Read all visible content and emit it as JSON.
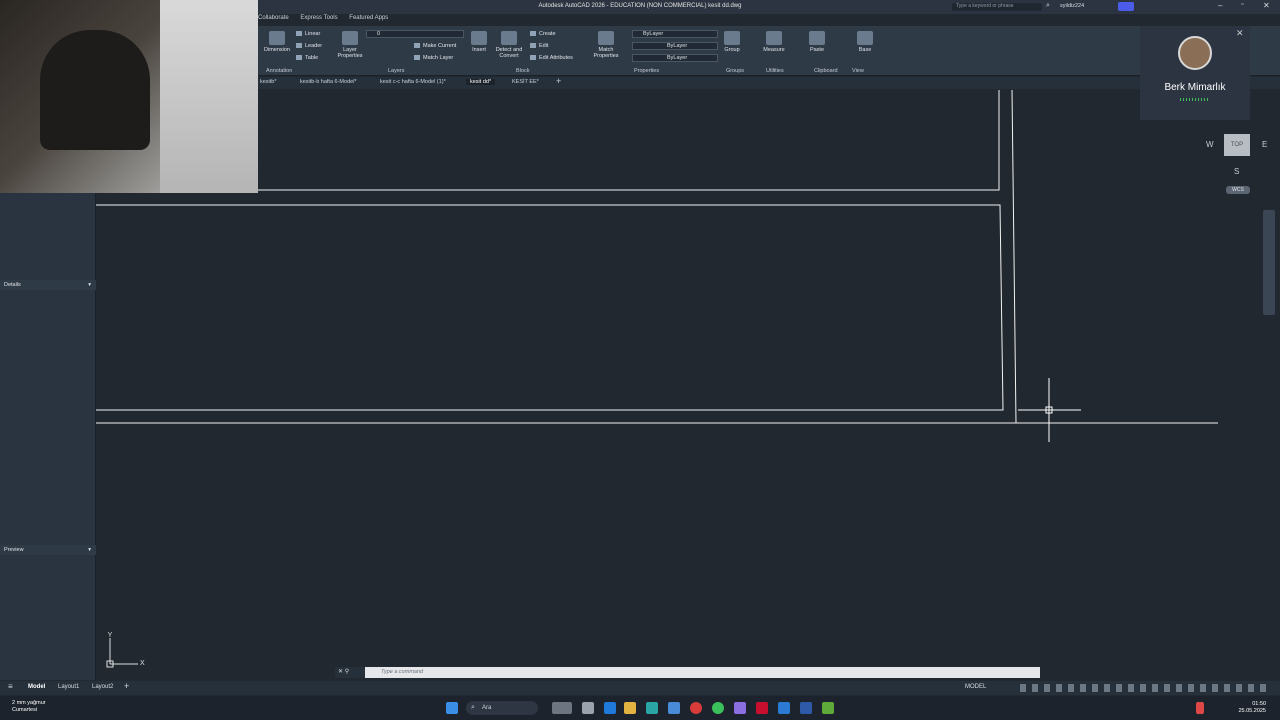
{
  "titlebar": {
    "title": "Autodesk AutoCAD 2026 - EDUCATION (NON COMMERCIAL)   kesit dd.dwg",
    "search_placeholder": "Type a keyword or phrase",
    "user": "syildiz224"
  },
  "menu_tabs": [
    "Collaborate",
    "Express Tools",
    "Featured Apps"
  ],
  "ribbon": {
    "dimension": "Dimension",
    "linear": "Linear",
    "leader": "Leader",
    "table": "Table",
    "annotation": "Annotation",
    "layer_properties": "Layer Properties",
    "make_current": "Make Current",
    "match_layer": "Match Layer",
    "layers": "Layers",
    "layer_value": "0",
    "insert": "Insert",
    "detect_convert": "Detect and Convert",
    "create": "Create",
    "edit": "Edit",
    "edit_attributes": "Edit Attributes",
    "block": "Block",
    "match_properties": "Match Properties",
    "bylayer_1": "ByLayer",
    "bylayer_2": "ByLayer",
    "bylayer_3": "ByLayer",
    "properties": "Properties",
    "group": "Group",
    "groups": "Groups",
    "measure": "Measure",
    "utilities": "Utilities",
    "paste": "Paste",
    "clipboard": "Clipboard",
    "base": "Base",
    "view": "View"
  },
  "file_tabs": [
    "kesitb*",
    "kesitb-b hafta 6-Model*",
    "kesit c-c hafta 6-Model (1)*",
    "kesit dd*",
    "KESİT EE*"
  ],
  "active_file_tab": "kesit dd*",
  "palette": {
    "details": "Details",
    "preview": "Preview"
  },
  "toast": {
    "name": "Berk Mimarlık"
  },
  "viewcube": {
    "top": "TOP",
    "w": "W",
    "e": "E",
    "s": "S",
    "wcs": "WCS"
  },
  "ucs": {
    "x": "X",
    "y": "Y"
  },
  "command": {
    "placeholder": "Type a command"
  },
  "layout_tabs": [
    "Model",
    "Layout1",
    "Layout2"
  ],
  "status": {
    "model": "MODEL"
  },
  "taskbar": {
    "weather_line1": "2 mm yağmur",
    "weather_line2": "Cumartesi",
    "search": "Ara",
    "time": "01:50",
    "date": "25.05.2025"
  }
}
